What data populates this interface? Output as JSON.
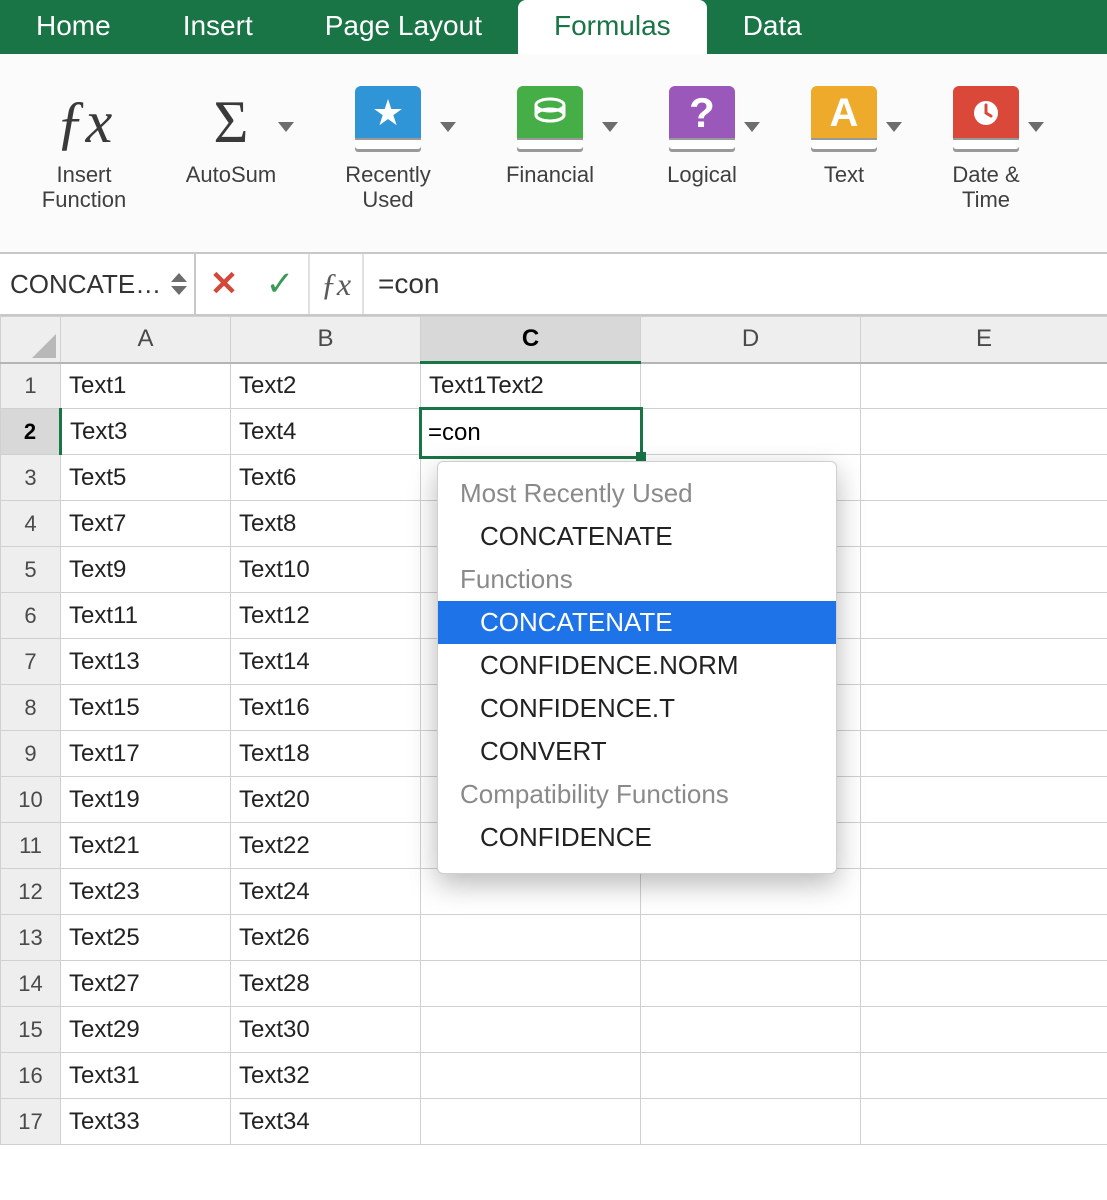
{
  "tabs": {
    "home": "Home",
    "insert": "Insert",
    "pagelayout": "Page Layout",
    "formulas": "Formulas",
    "data": "Data"
  },
  "active_tab": "formulas",
  "toolbar": {
    "insert_function": "Insert\nFunction",
    "autosum": "AutoSum",
    "recently_used": "Recently\nUsed",
    "financial": "Financial",
    "logical": "Logical",
    "text": "Text",
    "date_time": "Date &\nTime"
  },
  "formula_bar": {
    "name_box": "CONCATE…",
    "formula": "=con"
  },
  "columns": [
    "A",
    "B",
    "C",
    "D",
    "E"
  ],
  "selected_column_index": 2,
  "selected_row_index": 1,
  "rows": [
    {
      "n": 1,
      "cells": [
        "Text1",
        "Text2",
        "Text1Text2",
        "",
        ""
      ]
    },
    {
      "n": 2,
      "cells": [
        "Text3",
        "Text4",
        "=con",
        "",
        ""
      ]
    },
    {
      "n": 3,
      "cells": [
        "Text5",
        "Text6",
        "",
        "",
        ""
      ]
    },
    {
      "n": 4,
      "cells": [
        "Text7",
        "Text8",
        "",
        "",
        ""
      ]
    },
    {
      "n": 5,
      "cells": [
        "Text9",
        "Text10",
        "",
        "",
        ""
      ]
    },
    {
      "n": 6,
      "cells": [
        "Text11",
        "Text12",
        "",
        "",
        ""
      ]
    },
    {
      "n": 7,
      "cells": [
        "Text13",
        "Text14",
        "",
        "",
        ""
      ]
    },
    {
      "n": 8,
      "cells": [
        "Text15",
        "Text16",
        "",
        "",
        ""
      ]
    },
    {
      "n": 9,
      "cells": [
        "Text17",
        "Text18",
        "",
        "",
        ""
      ]
    },
    {
      "n": 10,
      "cells": [
        "Text19",
        "Text20",
        "",
        "",
        ""
      ]
    },
    {
      "n": 11,
      "cells": [
        "Text21",
        "Text22",
        "",
        "",
        ""
      ]
    },
    {
      "n": 12,
      "cells": [
        "Text23",
        "Text24",
        "",
        "",
        ""
      ]
    },
    {
      "n": 13,
      "cells": [
        "Text25",
        "Text26",
        "",
        "",
        ""
      ]
    },
    {
      "n": 14,
      "cells": [
        "Text27",
        "Text28",
        "",
        "",
        ""
      ]
    },
    {
      "n": 15,
      "cells": [
        "Text29",
        "Text30",
        "",
        "",
        ""
      ]
    },
    {
      "n": 16,
      "cells": [
        "Text31",
        "Text32",
        "",
        "",
        ""
      ]
    },
    {
      "n": 17,
      "cells": [
        "Text33",
        "Text34",
        "",
        "",
        ""
      ]
    }
  ],
  "active_cell": {
    "row": 2,
    "col": "C",
    "value": "=con"
  },
  "icon_colors": {
    "recent": "#2f95d6",
    "financial": "#46ae47",
    "logical": "#9a58bb",
    "text": "#eeaa2b",
    "datetime": "#d94838"
  },
  "autocomplete": {
    "sections": [
      {
        "title": "Most Recently Used",
        "items": [
          "CONCATENATE"
        ]
      },
      {
        "title": "Functions",
        "items": [
          "CONCATENATE",
          "CONFIDENCE.NORM",
          "CONFIDENCE.T",
          "CONVERT"
        ]
      },
      {
        "title": "Compatibility Functions",
        "items": [
          "CONFIDENCE"
        ]
      }
    ],
    "selected": {
      "section": 1,
      "index": 0
    }
  }
}
